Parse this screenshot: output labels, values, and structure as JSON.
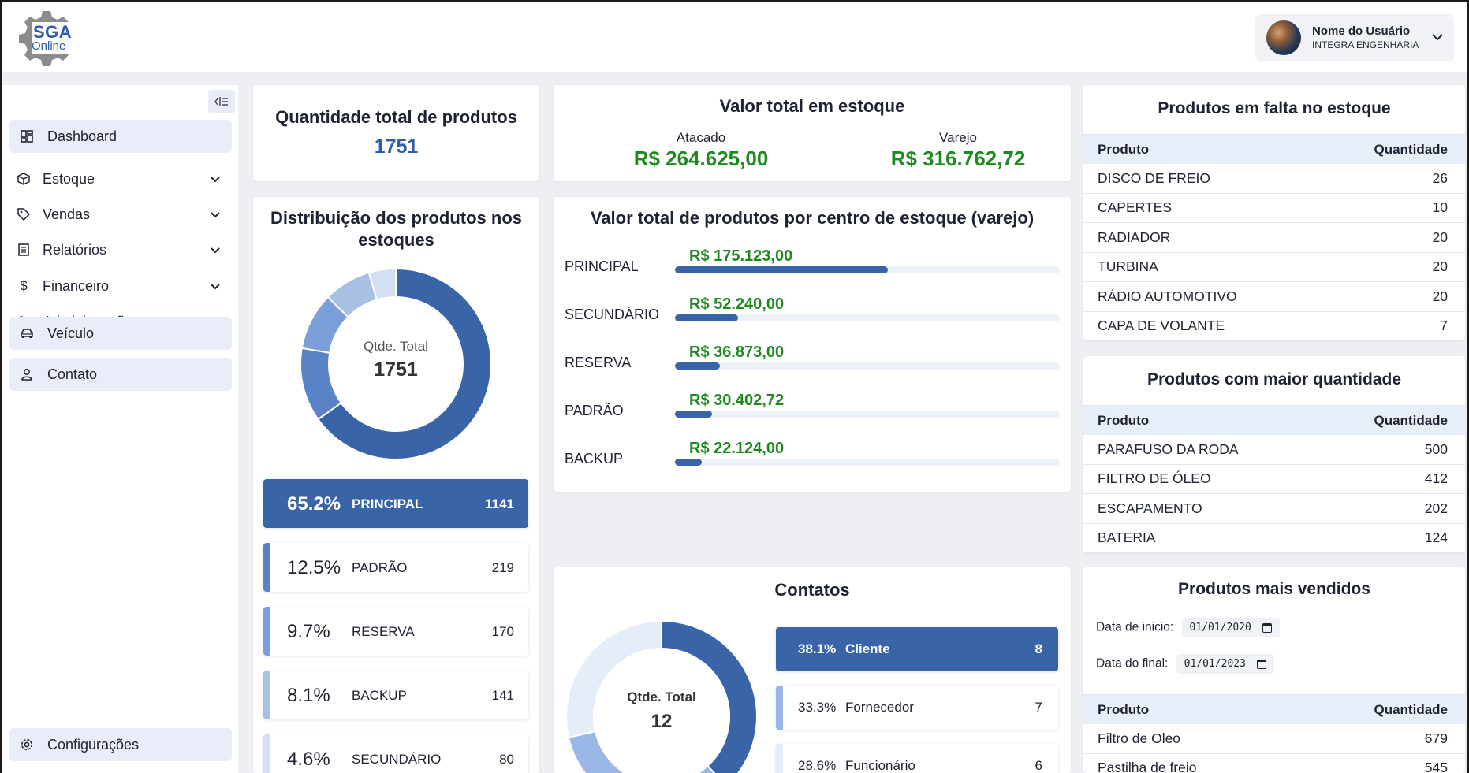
{
  "header": {
    "logo_main": "SGA",
    "logo_sub": "Online",
    "user_name": "Nome do Usuário",
    "user_org": "INTEGRA ENGENHARIA"
  },
  "sidebar": {
    "items": [
      {
        "label": "Dashboard",
        "icon": "dashboard-icon"
      },
      {
        "label": "Estoque",
        "icon": "box-icon"
      },
      {
        "label": "Vendas",
        "icon": "tag-icon"
      },
      {
        "label": "Relatórios",
        "icon": "report-icon"
      },
      {
        "label": "Financeiro",
        "icon": "dollar-icon"
      },
      {
        "label": "Administração",
        "icon": "users-gear-icon"
      },
      {
        "label": "Veículo",
        "icon": "car-icon"
      },
      {
        "label": "Contato",
        "icon": "person-icon"
      }
    ],
    "settings_label": "Configurações"
  },
  "total_produtos": {
    "title": "Quantidade total de produtos",
    "value": "1751"
  },
  "valor_total": {
    "title": "Valor total em estoque",
    "atacado_label": "Atacado",
    "atacado_value": "R$ 264.625,00",
    "varejo_label": "Varejo",
    "varejo_value": "R$ 316.762,72"
  },
  "distribuicao": {
    "title_line1": "Distribuição dos produtos nos",
    "title_line2": "estoques",
    "donut_label": "Qtde. Total",
    "donut_value": "1751",
    "items": [
      {
        "pct": "65.2%",
        "name": "PRINCIPAL",
        "count": "1141",
        "color": "#3a64a8"
      },
      {
        "pct": "12.5%",
        "name": "PADRÃO",
        "count": "219",
        "color": "#5a82c7"
      },
      {
        "pct": "9.7%",
        "name": "RESERVA",
        "count": "170",
        "color": "#7b9fd8"
      },
      {
        "pct": "8.1%",
        "name": "BACKUP",
        "count": "141",
        "color": "#a9bfe4"
      },
      {
        "pct": "4.6%",
        "name": "SECUNDÁRIO",
        "count": "80",
        "color": "#d3dff2"
      }
    ]
  },
  "chart_data": {
    "type": "bar",
    "title": "Valor total de produtos por centro de estoque (varejo)",
    "categories": [
      "PRINCIPAL",
      "SECUNDÁRIO",
      "RESERVA",
      "PADRÃO",
      "BACKUP"
    ],
    "values": [
      175123.0,
      52240.0,
      36873.0,
      30402.72,
      22124.0
    ],
    "value_labels": [
      "R$ 175.123,00",
      "R$ 52.240,00",
      "R$ 36.873,00",
      "R$ 30.402,72",
      "R$ 22.124,00"
    ],
    "max": 316762.72,
    "bar_color": "#3a64a8",
    "value_color": "#1d8a1d"
  },
  "contatos": {
    "title": "Contatos",
    "donut_label": "Qtde. Total",
    "donut_value": "12",
    "items": [
      {
        "pct": "38.1%",
        "name": "Cliente",
        "count": "8",
        "color": "#3a64a8"
      },
      {
        "pct": "33.3%",
        "name": "Fornecedor",
        "count": "7",
        "color": "#9ab7e6"
      },
      {
        "pct": "28.6%",
        "name": "Funcionário",
        "count": "6",
        "color": "#e6edfa"
      }
    ]
  },
  "falta": {
    "title": "Produtos em falta no estoque",
    "col1": "Produto",
    "col2": "Quantidade",
    "rows": [
      {
        "name": "DISCO DE FREIO",
        "qty": "26"
      },
      {
        "name": "CAPERTES",
        "qty": "10"
      },
      {
        "name": "RADIADOR",
        "qty": "20"
      },
      {
        "name": "TURBINA",
        "qty": "20"
      },
      {
        "name": "RÁDIO AUTOMOTIVO",
        "qty": "20"
      },
      {
        "name": "CAPA DE VOLANTE",
        "qty": "7"
      }
    ]
  },
  "maior": {
    "title": "Produtos com maior quantidade",
    "col1": "Produto",
    "col2": "Quantidade",
    "rows": [
      {
        "name": "PARAFUSO DA RODA",
        "qty": "500"
      },
      {
        "name": "FILTRO DE ÓLEO",
        "qty": "412"
      },
      {
        "name": "ESCAPAMENTO",
        "qty": "202"
      },
      {
        "name": "BATERIA",
        "qty": "124"
      }
    ]
  },
  "vendidos": {
    "title": "Produtos mais vendidos",
    "start_label": "Data de inicio:",
    "start_value": "01/01/2020",
    "end_label": "Data do final:",
    "end_value": "01/01/2023",
    "col1": "Produto",
    "col2": "Quantidade",
    "rows": [
      {
        "name": "Filtro de Oleo",
        "qty": "679"
      },
      {
        "name": "Pastilha de freio",
        "qty": "545"
      }
    ]
  }
}
